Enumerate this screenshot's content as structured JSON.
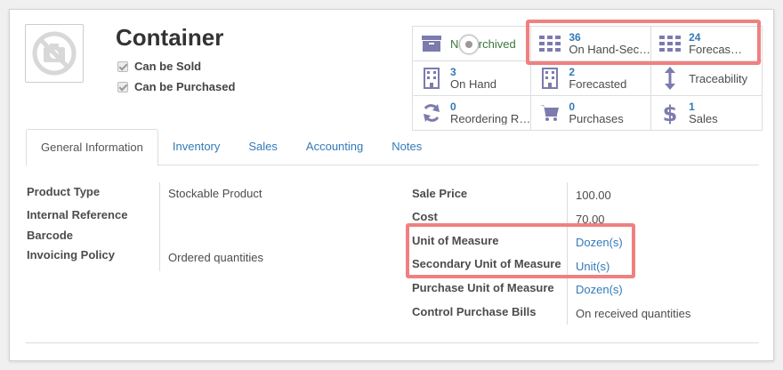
{
  "product": {
    "title": "Container",
    "can_be_sold_label": "Can be Sold",
    "can_be_purchased_label": "Can be Purchased"
  },
  "stats": {
    "archived": "Not Archived",
    "on_hand_sec_value": "36",
    "on_hand_sec_label": "On Hand-Sec…",
    "forecast_sec_value": "24",
    "forecast_sec_label": "Forecas…",
    "on_hand_value": "3",
    "on_hand_label": "On Hand",
    "forecasted_value": "2",
    "forecasted_label": "Forecasted",
    "traceability_label": "Traceability",
    "reordering_value": "0",
    "reordering_label": "Reordering R…",
    "purchases_value": "0",
    "purchases_label": "Purchases",
    "sales_value": "1",
    "sales_label": "Sales"
  },
  "tabs": {
    "general": "General Information",
    "inventory": "Inventory",
    "sales": "Sales",
    "accounting": "Accounting",
    "notes": "Notes"
  },
  "left_fields": {
    "product_type_label": "Product Type",
    "product_type_value": "Stockable Product",
    "internal_ref_label": "Internal Reference",
    "barcode_label": "Barcode",
    "invoicing_policy_label": "Invoicing Policy",
    "invoicing_policy_value": "Ordered quantities"
  },
  "right_fields": {
    "sale_price_label": "Sale Price",
    "sale_price_value": "100.00",
    "cost_label": "Cost",
    "cost_value": "70.00",
    "uom_label": "Unit of Measure",
    "uom_value": "Dozen(s)",
    "secondary_uom_label": "Secondary Unit of Measure",
    "secondary_uom_value": "Unit(s)",
    "purchase_uom_label": "Purchase Unit of Measure",
    "purchase_uom_value": "Dozen(s)",
    "control_bills_label": "Control Purchase Bills",
    "control_bills_value": "On received quantities"
  },
  "colors": {
    "highlight": "#f08080",
    "link": "#337ab7",
    "icon": "#7c7bad"
  }
}
